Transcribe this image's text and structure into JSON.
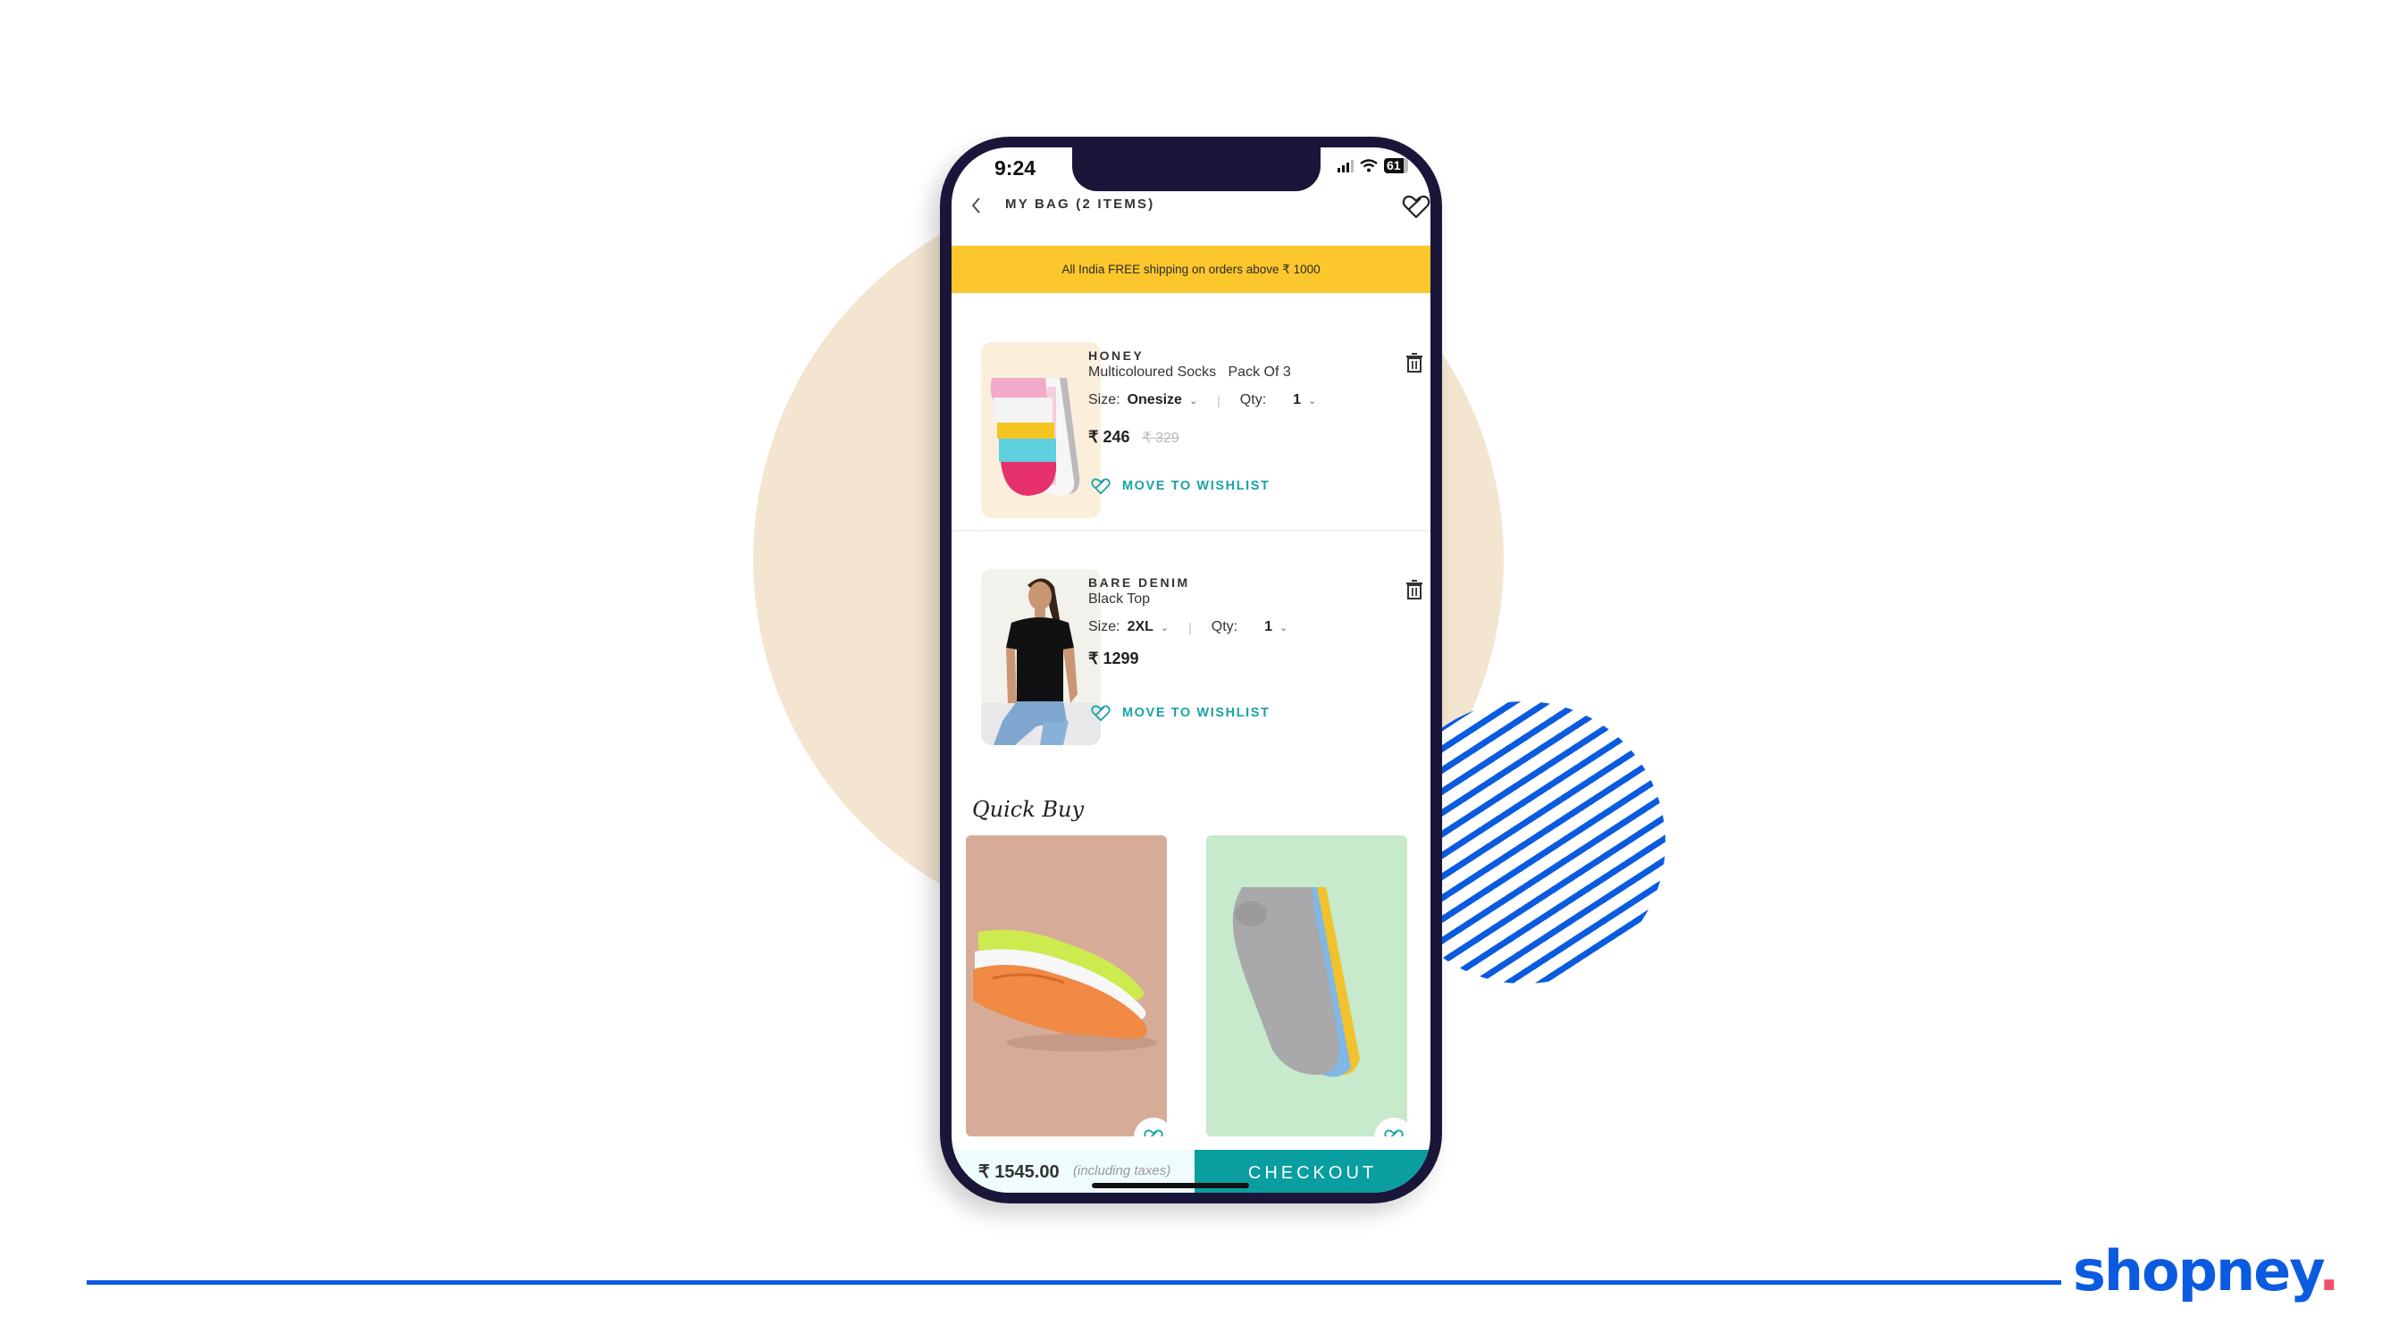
{
  "brand": {
    "logo_text": "shopney",
    "logo_dot": ".",
    "colors": {
      "primary": "#0B5BE0",
      "dot": "#F0506E",
      "beige": "#F4E5D1",
      "phone_frame": "#19163A"
    }
  },
  "status_bar": {
    "time": "9:24",
    "battery": "61",
    "icons": [
      "signal-icon",
      "wifi-icon",
      "battery-icon"
    ]
  },
  "header": {
    "back_icon": "chevron-left-icon",
    "title": "MY BAG (2 ITEMS)",
    "wishlist_icon": "heart-icon"
  },
  "banner": {
    "text": "All India FREE shipping on orders above ₹ 1000",
    "color": "#FCC72C"
  },
  "cart_items": [
    {
      "brand": "HONEY",
      "name": "Multicoloured Socks   Pack Of 3",
      "size_label": "Size:",
      "size": "Onesize",
      "qty_label": "Qty:",
      "qty": "1",
      "price": "₹ 246",
      "mrp": "₹ 329",
      "wishlist_label": "MOVE TO WISHLIST",
      "image": "multicoloured-socks"
    },
    {
      "brand": "BARE DENIM",
      "name": "Black Top",
      "size_label": "Size:",
      "size": "2XL",
      "qty_label": "Qty:",
      "qty": "1",
      "price": "₹ 1299",
      "mrp": "",
      "wishlist_label": "MOVE TO WISHLIST",
      "image": "woman-black-top"
    }
  ],
  "quick_buy": {
    "title": "Quick Buy",
    "products": [
      {
        "image": "neon-no-show-socks",
        "bg": "#D6AC99"
      },
      {
        "image": "grey-ankle-socks",
        "bg": "#C6EACB"
      }
    ]
  },
  "footer": {
    "total": "₹ 1545.00",
    "tax_note": "(including taxes)",
    "checkout_label": "CHECKOUT",
    "checkout_color": "#0A9EA0"
  }
}
